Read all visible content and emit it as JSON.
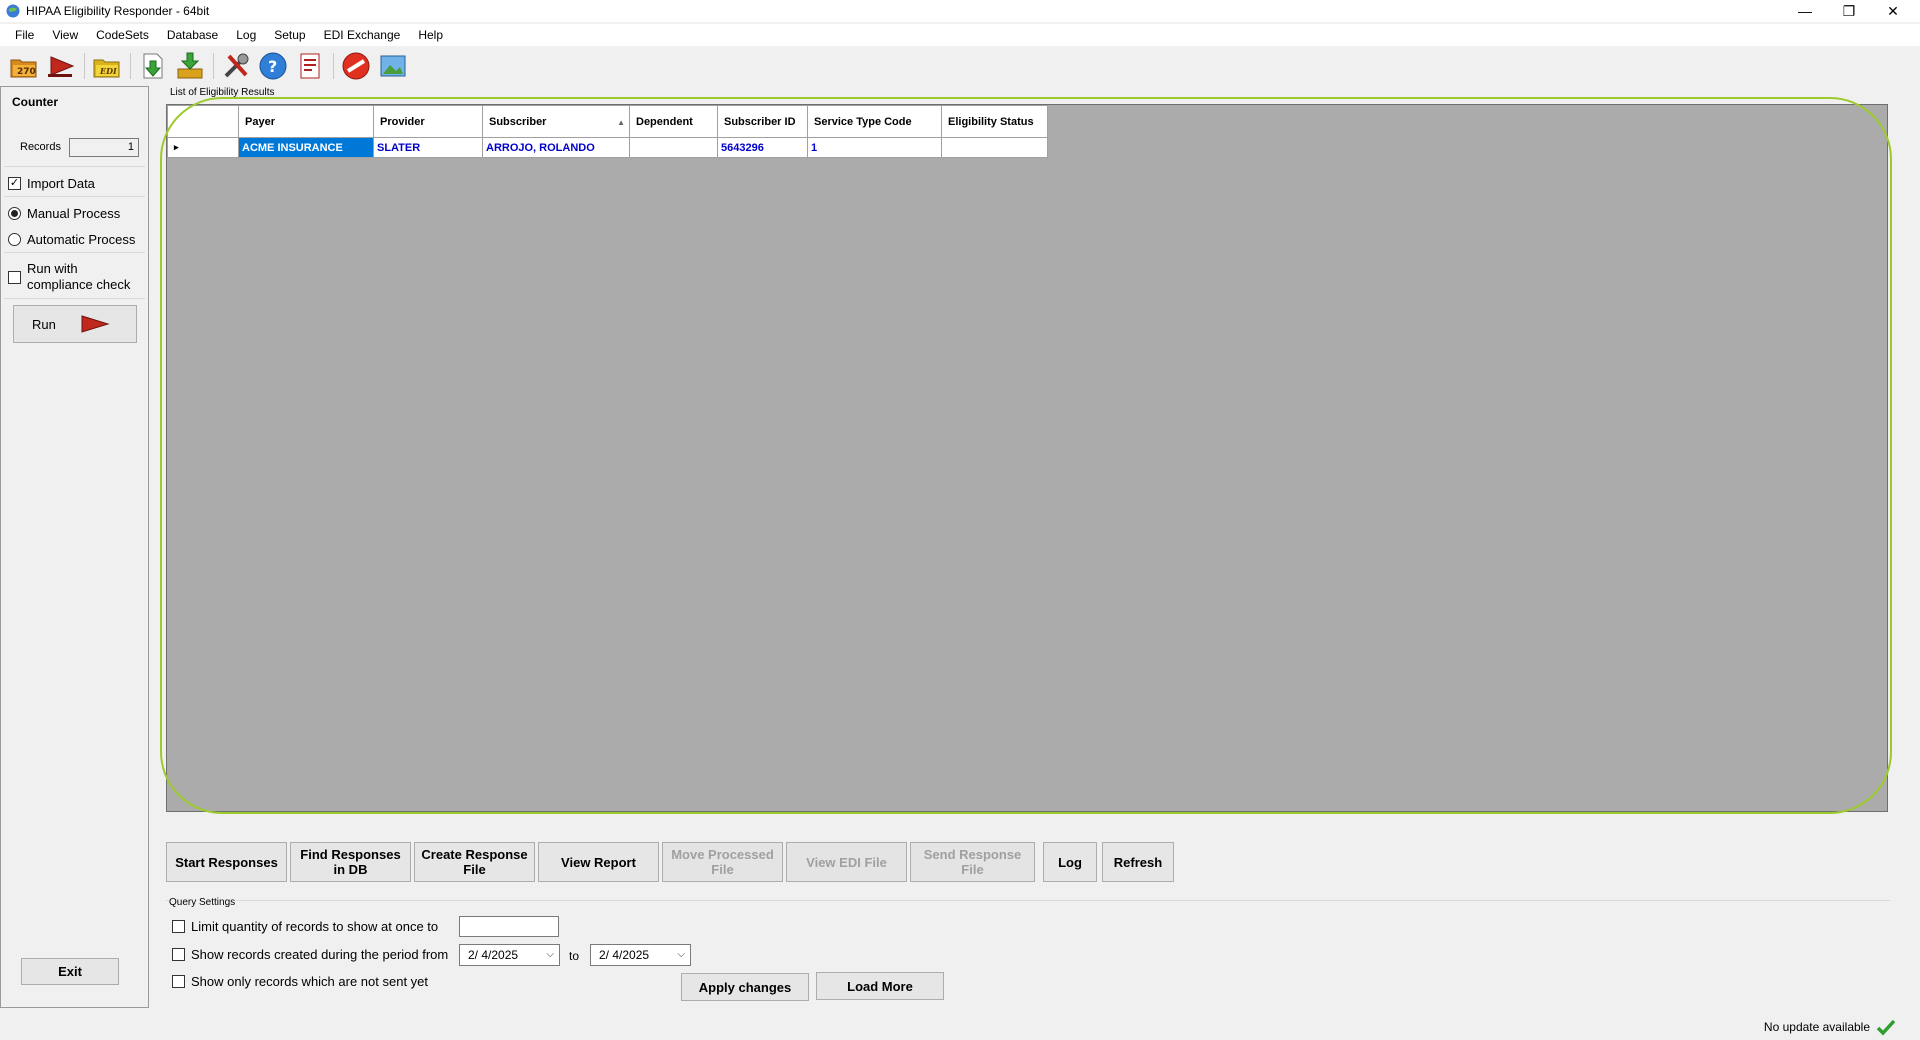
{
  "window": {
    "title": "HIPAA Eligibility Responder - 64bit",
    "controls": {
      "minimize": "—",
      "maximize": "❐",
      "close": "✕"
    }
  },
  "menu": [
    "File",
    "View",
    "CodeSets",
    "Database",
    "Log",
    "Setup",
    "EDI Exchange",
    "Help"
  ],
  "toolbar": {
    "icons": [
      "open-270-icon",
      "run-icon",
      "edi-folder-icon",
      "import-icon",
      "export-icon",
      "tools-icon",
      "help-icon",
      "report-icon",
      "stop-icon",
      "picture-icon"
    ],
    "badge_270": "270",
    "badge_edi": "EDI",
    "help_glyph": "?"
  },
  "left_panel": {
    "counter_title": "Counter",
    "records_label": "Records",
    "records_value": "1",
    "import_data": {
      "label": "Import Data",
      "checked": true
    },
    "manual_process": {
      "label": "Manual Process",
      "selected": true
    },
    "automatic_process": {
      "label": "Automatic Process",
      "selected": false
    },
    "compliance": {
      "label_line1": "Run with",
      "label_line2": "compliance check",
      "checked": false
    },
    "run_label": "Run",
    "exit_label": "Exit"
  },
  "grid": {
    "caption": "List of Eligibility Results",
    "columns": [
      "Payer",
      "Provider",
      "Subscriber",
      "Dependent",
      "Subscriber ID",
      "Service Type Code",
      "Eligibility Status"
    ],
    "sorted_column": "Subscriber",
    "rows": [
      {
        "Payer": "ACME INSURANCE",
        "Provider": "SLATER",
        "Subscriber": "ARROJO, ROLANDO",
        "Dependent": "",
        "Subscriber ID": "5643296",
        "Service Type Code": "1",
        "Eligibility Status": ""
      }
    ],
    "row_marker": "▸",
    "sort_glyph": "▲"
  },
  "actions": [
    {
      "label": "Start Responses",
      "enabled": true
    },
    {
      "label": "Find Responses in DB",
      "enabled": true
    },
    {
      "label": "Create Response File",
      "enabled": true
    },
    {
      "label": "View Report",
      "enabled": true
    },
    {
      "label": "Move Processed File",
      "enabled": false
    },
    {
      "label": "View EDI File",
      "enabled": false
    },
    {
      "label": "Send Response File",
      "enabled": false
    },
    {
      "label": "Log",
      "enabled": true
    },
    {
      "label": "Refresh",
      "enabled": true
    }
  ],
  "query_settings": {
    "title": "Query Settings",
    "limit": {
      "label": "Limit quantity of records to show at once to",
      "checked": false,
      "value": ""
    },
    "period": {
      "label": "Show records created during the period from",
      "checked": false,
      "from": "2/  4/2025",
      "to_label": "to",
      "to": "2/  4/2025"
    },
    "not_sent": {
      "label": "Show only records which are not sent yet",
      "checked": false
    },
    "apply_label": "Apply changes",
    "load_more_label": "Load More",
    "dropdown_glyph": "⌵"
  },
  "status": {
    "text": "No update available",
    "ok_color": "#2e9e2e"
  },
  "colors": {
    "selection": "#0078d7",
    "link_text": "#0000cc",
    "highlight_ring": "#9ccb2d",
    "grid_background": "#ababab"
  }
}
